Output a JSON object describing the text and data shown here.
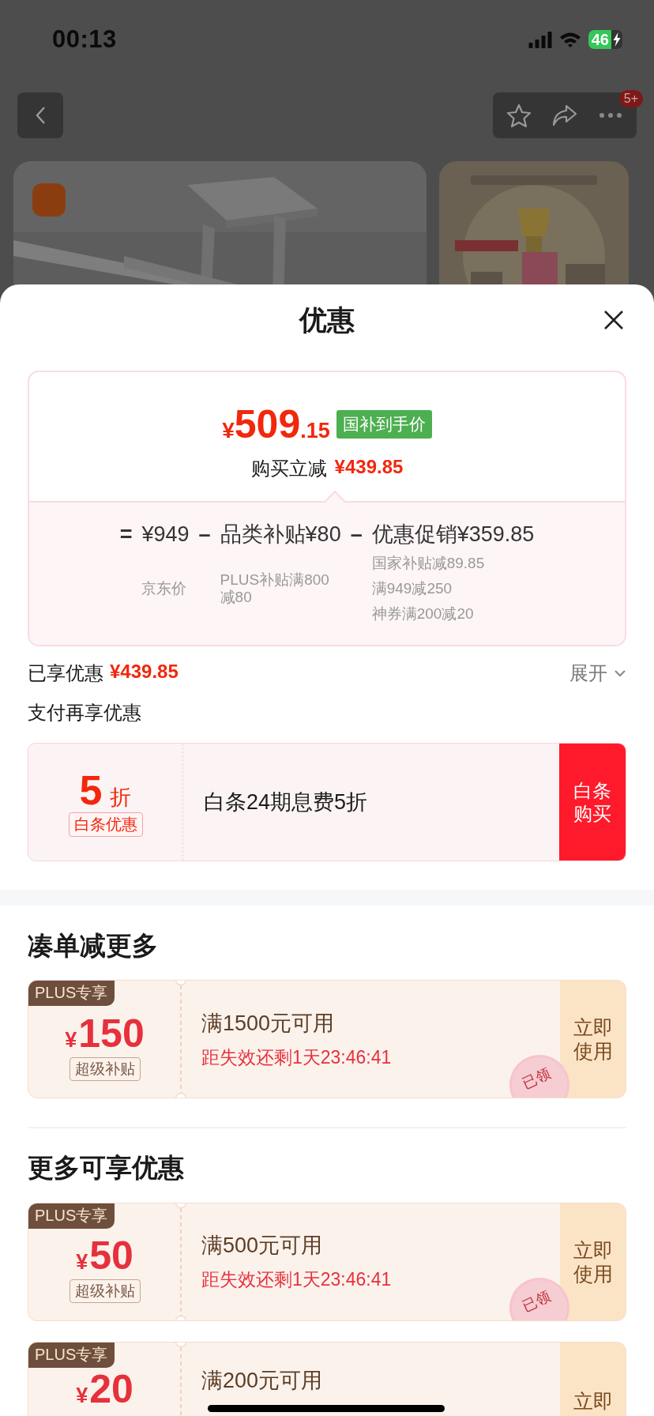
{
  "status_bar": {
    "time": "00:13",
    "battery": "46"
  },
  "nav": {
    "badge": "5+"
  },
  "sheet": {
    "title": "优惠",
    "price_card": {
      "currency": "¥",
      "price_main": "509",
      "price_decimal": ".15",
      "price_tag": "国补到手价",
      "saving_label": "购买立减",
      "saving_amount": "¥439.85",
      "breakdown": [
        {
          "operator": "=",
          "amount": "¥949",
          "notes": [
            "京东价"
          ]
        },
        {
          "operator": "–",
          "label": "品类补贴",
          "amount": "¥80",
          "notes": [
            "PLUS补贴满800减80"
          ]
        },
        {
          "operator": "–",
          "label": "优惠促销",
          "amount": "¥359.85",
          "notes": [
            "国家补贴减89.85",
            "满949减250",
            "神券满200减20"
          ]
        }
      ]
    },
    "enjoyed": {
      "label": "已享优惠",
      "amount": "¥439.85",
      "toggle": "展开"
    },
    "pay_title": "支付再享优惠",
    "pay_offer": {
      "discount": "5",
      "unit": "折",
      "badge": "白条优惠",
      "description": "白条24期息费5折",
      "button": "白条购买"
    },
    "sections": [
      {
        "title": "凑单减更多",
        "coupons": [
          {
            "tag": "PLUS专享",
            "currency": "¥",
            "amount": "150",
            "badge": "超级补贴",
            "condition": "满1500元可用",
            "countdown": "距失效还剩1天23:46:41",
            "stamp": "已领",
            "action": "立即使用"
          }
        ]
      },
      {
        "title": "更多可享优惠",
        "coupons": [
          {
            "tag": "PLUS专享",
            "currency": "¥",
            "amount": "50",
            "badge": "超级补贴",
            "condition": "满500元可用",
            "countdown": "距失效还剩1天23:46:41",
            "stamp": "已领",
            "action": "立即使用"
          },
          {
            "tag": "PLUS专享",
            "currency": "¥",
            "amount": "20",
            "condition": "满200元可用",
            "action": "立即"
          }
        ]
      }
    ]
  }
}
